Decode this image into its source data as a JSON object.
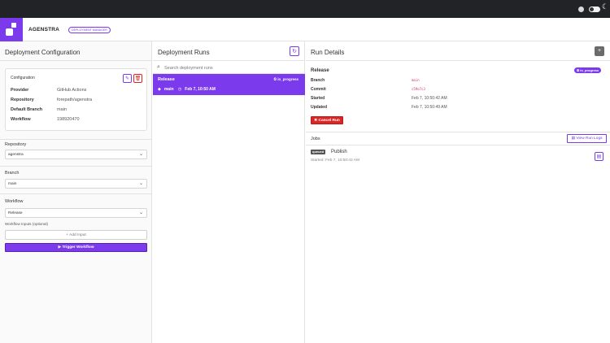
{
  "app": {
    "name": "AGENSTRA",
    "badge": "DEPLOYMENT MANAGER"
  },
  "topbar": {
    "theme_icon": "moon-icon"
  },
  "config": {
    "title": "Deployment Configuration",
    "card_label": "Configuration",
    "rows": [
      {
        "key": "Provider",
        "value": "GitHub Actions"
      },
      {
        "key": "Repository",
        "value": "forepath/agenstra"
      },
      {
        "key": "Default Branch",
        "value": "main"
      },
      {
        "key": "Workflow",
        "value": "198920470"
      }
    ],
    "repository_label": "Repository",
    "repository_value": "agenstra",
    "branch_label": "Branch",
    "branch_value": "main",
    "workflow_label": "Workflow",
    "workflow_value": "Release",
    "inputs_label": "Workflow Inputs (optional)",
    "add_input_label": "+ Add Input",
    "trigger_label": "▶ Trigger Workflow"
  },
  "runs": {
    "title": "Deployment Runs",
    "search_placeholder": "Search deployment runs",
    "items": [
      {
        "name": "Release",
        "status": "⏲ in_progress",
        "branch": "main",
        "time": "Feb 7, 10:50 AM"
      }
    ]
  },
  "details": {
    "title": "Run Details",
    "name": "Release",
    "status": "⏲ in_progress",
    "rows": [
      {
        "key": "Branch",
        "value": "main",
        "code": true
      },
      {
        "key": "Commit",
        "value": "c59e7c3",
        "code": true
      },
      {
        "key": "Started",
        "value": "Feb 7, 10:50:42 AM",
        "code": false
      },
      {
        "key": "Updated",
        "value": "Feb 7, 10:50:49 AM",
        "code": false
      }
    ],
    "cancel_label": "✖ Cancel Run",
    "jobs_title": "Jobs",
    "view_logs_label": "View Run Logs",
    "jobs": [
      {
        "status": "queued",
        "name": "Publish",
        "started": "Started: Feb 7, 10:50:42 AM"
      }
    ]
  },
  "colors": {
    "accent": "#7c3aed",
    "danger": "#dc2626"
  }
}
